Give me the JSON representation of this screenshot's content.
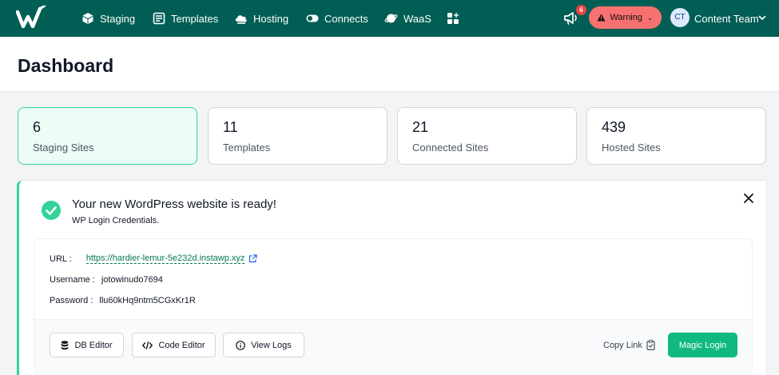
{
  "nav": {
    "items": [
      {
        "label": "Staging",
        "icon": "cube-icon"
      },
      {
        "label": "Templates",
        "icon": "templates-icon"
      },
      {
        "label": "Hosting",
        "icon": "cloud-icon"
      },
      {
        "label": "Connects",
        "icon": "toggle-icon"
      },
      {
        "label": "WaaS",
        "icon": "planet-icon"
      }
    ],
    "apps_icon": "apps-plus-icon",
    "notification_count": "6",
    "warning_label": "Warning",
    "user_initials": "CT",
    "user_name": "Content Team"
  },
  "page": {
    "title": "Dashboard"
  },
  "stats": [
    {
      "value": "6",
      "label": "Staging Sites"
    },
    {
      "value": "11",
      "label": "Templates"
    },
    {
      "value": "21",
      "label": "Connected Sites"
    },
    {
      "value": "439",
      "label": "Hosted Sites"
    }
  ],
  "panel": {
    "title": "Your new WordPress website is ready!",
    "subtitle": "WP Login Credentials.",
    "url_label": "URL :",
    "url": "https://hardier-lemur-5e232d.instawp.xyz",
    "username_label": "Username :",
    "username": "jotowinudo7694",
    "password_label": "Password :",
    "password": "llu60kHq9ntm5CGxKr1R",
    "buttons": {
      "db_editor": "DB Editor",
      "code_editor": "Code Editor",
      "view_logs": "View Logs",
      "copy_link": "Copy Link",
      "magic_login": "Magic Login"
    }
  },
  "colors": {
    "nav_bg": "#005e54",
    "warning_bg": "#f87171",
    "accent": "#10b981",
    "active_card_bg": "#ecfdf5"
  }
}
